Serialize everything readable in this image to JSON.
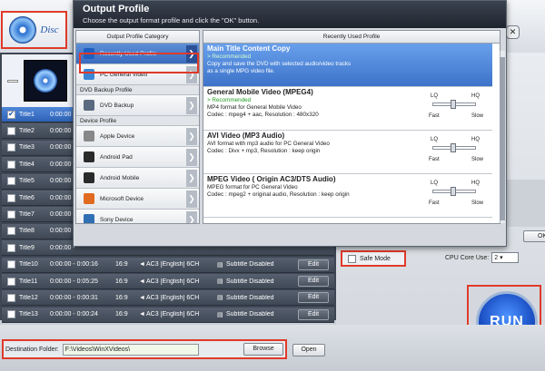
{
  "app": {
    "disc_label": "Disc",
    "safe_mode_label": "Safe Mode",
    "cpu_label": "CPU Core Use:",
    "cpu_value": "2",
    "run_label": "RUN",
    "dest_label": "Destination Folder:",
    "dest_value": "F:\\Videos\\WinXVideos\\",
    "browse_label": "Browse",
    "open_label": "Open"
  },
  "titles": [
    {
      "name": "Title1",
      "time": "0:00:00 -",
      "selected": true
    },
    {
      "name": "Title2",
      "time": "0:00:00 -"
    },
    {
      "name": "Title3",
      "time": "0:00:00 -"
    },
    {
      "name": "Title4",
      "time": "0:00:00 -"
    },
    {
      "name": "Title5",
      "time": "0:00:00 -"
    },
    {
      "name": "Title6",
      "time": "0:00:00 -"
    },
    {
      "name": "Title7",
      "time": "0:00:00 -"
    },
    {
      "name": "Title8",
      "time": "0:00:00 -"
    },
    {
      "name": "Title9",
      "time": "0:00:00 -"
    },
    {
      "name": "Title10",
      "time": "0:00:00 - 0:00:16",
      "aspect": "16:9",
      "audio": "AC3  [English]  6CH",
      "sub": "Subtitle Disabled",
      "edit": "Edit"
    },
    {
      "name": "Title11",
      "time": "0:00:00 - 0:05:25",
      "aspect": "16:9",
      "audio": "AC3  [English]  6CH",
      "sub": "Subtitle Disabled",
      "edit": "Edit"
    },
    {
      "name": "Title12",
      "time": "0:00:00 - 0:00:31",
      "aspect": "16:9",
      "audio": "AC3  [English]  6CH",
      "sub": "Subtitle Disabled",
      "edit": "Edit"
    },
    {
      "name": "Title13",
      "time": "0:00:00 - 0:00:24",
      "aspect": "16:9",
      "audio": "AC3  [English]  6CH",
      "sub": "Subtitle Disabled",
      "edit": "Edit"
    }
  ],
  "dialog": {
    "title": "Output Profile",
    "subtitle": "Choose the output format profile and click the \"OK\" button.",
    "cat_header": "Output Profile Category",
    "prof_header": "Recently Used Profile",
    "ok_label": "OK",
    "categories": [
      {
        "label": "Recently Used Profile",
        "selected": true,
        "color": "#1f5fbf"
      },
      {
        "label": "PC General Video",
        "color": "#3b86d4"
      }
    ],
    "section_backup": "DVD Backup Profile",
    "categories_backup": [
      {
        "label": "DVD Backup",
        "color": "#5a6a80"
      }
    ],
    "section_device": "Device Profile",
    "categories_device": [
      {
        "label": "Apple Device",
        "color": "#888888"
      },
      {
        "label": "Android Pad",
        "color": "#2a2a2a"
      },
      {
        "label": "Android Mobile",
        "color": "#2a2a2a"
      },
      {
        "label": "Microsoft Device",
        "color": "#e06a1f"
      },
      {
        "label": "Sony Device",
        "color": "#2f6fb3"
      }
    ],
    "profiles": [
      {
        "name": "Main Title Content Copy",
        "rec": "> Recommended",
        "desc1": "Copy and save the DVD with selected audio/video tracks",
        "desc2": "as a single MPG video file.",
        "selected": true
      },
      {
        "name": "General Mobile Video (MPEG4)",
        "rec": "> Recommended",
        "desc1": "MP4 format for General Mobile Video",
        "desc2": "Codec : mpeg4 + aac, Resolution : 480x320",
        "quality": true
      },
      {
        "name": "AVI Video (MP3 Audio)",
        "rec": "",
        "desc1": "AVI format with mp3 audio for PC General Video",
        "desc2": "Codec : Divx + mp3, Resolution : keep origin",
        "quality": true
      },
      {
        "name": "MPEG Video ( Origin AC3/DTS Audio)",
        "rec": "",
        "desc1": "MPEG format for PC General Video",
        "desc2": "Codec : mpeg2 + original audio, Resolution : keep origin",
        "quality": true
      }
    ],
    "quality_labels": {
      "lq": "LQ",
      "hq": "HQ",
      "fast": "Fast",
      "slow": "Slow"
    }
  }
}
